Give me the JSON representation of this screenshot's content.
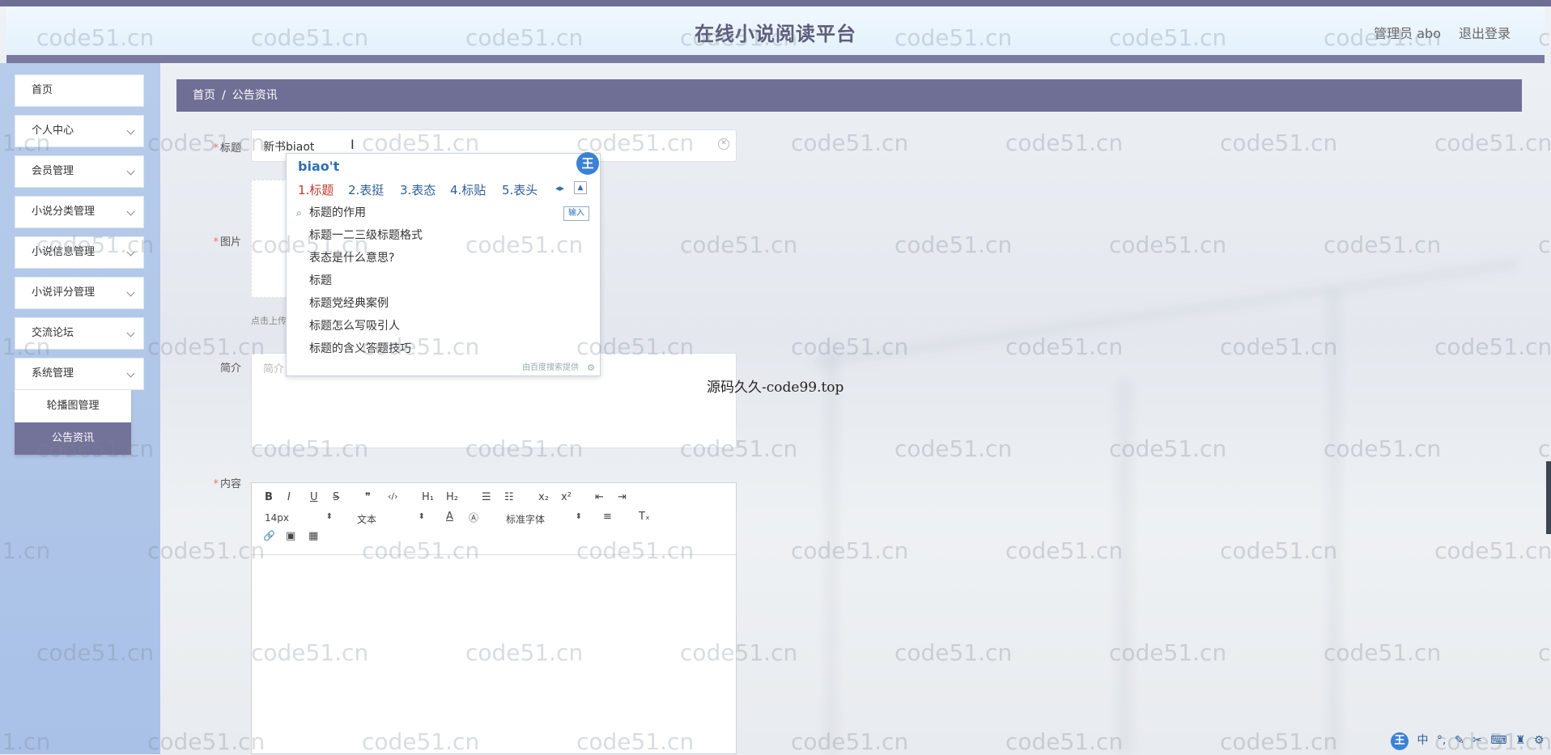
{
  "header": {
    "title": "在线小说阅读平台",
    "user": "管理员 abo",
    "logout": "退出登录"
  },
  "sidebar": {
    "items": [
      {
        "label": "首页"
      },
      {
        "label": "个人中心"
      },
      {
        "label": "会员管理"
      },
      {
        "label": "小说分类管理"
      },
      {
        "label": "小说信息管理"
      },
      {
        "label": "小说评分管理"
      },
      {
        "label": "交流论坛"
      },
      {
        "label": "系统管理"
      }
    ],
    "submenu": [
      {
        "label": "轮播图管理"
      },
      {
        "label": "公告资讯"
      }
    ]
  },
  "breadcrumb": {
    "home": "首页",
    "sep": "/",
    "current": "公告资讯"
  },
  "form": {
    "title_label": "标题",
    "title_value": "新书biaot",
    "image_label": "图片",
    "image_hint": "点击上传",
    "intro_label": "简介",
    "intro_placeholder": "简介",
    "content_label": "内容",
    "required_mark": "*"
  },
  "editor": {
    "font_size": "14px",
    "text_style": "文本",
    "font_family": "标准字体",
    "tools": {
      "bold": "B",
      "italic": "I",
      "underline": "U",
      "strike": "S",
      "quote": "❞",
      "code": "‹/›",
      "h1": "H₁",
      "h2": "H₂",
      "ordered": "☰",
      "bullet": "☷",
      "sub": "x₂",
      "sup": "x²",
      "outdent": "⇤",
      "indent": "⇥",
      "color": "A",
      "bg": "Ⓐ",
      "align": "≡",
      "clear": "Tₓ",
      "link": "🔗",
      "image": "▣",
      "video": "▦"
    }
  },
  "ime": {
    "input": "biao't",
    "candidates": [
      "1.标题",
      "2.表挺",
      "3.表态",
      "4.标贴",
      "5.表头"
    ],
    "suggestions": [
      "标题的作用",
      "标题一二三级标题格式",
      "表态是什么意思?",
      "标题",
      "标题党经典案例",
      "标题怎么写吸引人",
      "标题的含义答题技巧"
    ],
    "enter_label": "输入",
    "footer": "由百度搜索提供",
    "badge": "王"
  },
  "watermark": {
    "text": "code51.cn",
    "source": "源码久久-code99.top"
  },
  "tray": {
    "badge": "王",
    "lang": "中"
  },
  "colors": {
    "header_bar": "#6e6e94",
    "breadcrumb_bg": "#6f6f95",
    "sidebar_bg": "#b7ccea",
    "active_submenu": "#73739a",
    "required": "#f56c6c"
  }
}
